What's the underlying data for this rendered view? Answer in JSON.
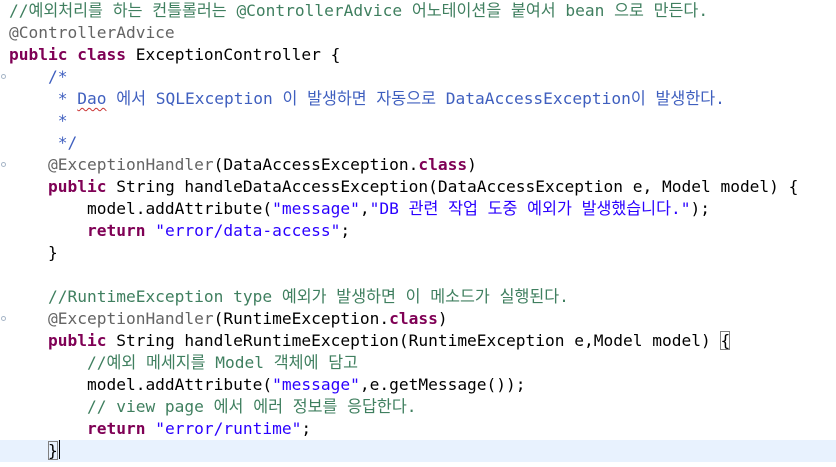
{
  "editor": {
    "current_line": 20,
    "lines": [
      {
        "fold": false,
        "segs": [
          {
            "t": "//예외처리를 하는 컨틀롤러는 @ControllerAdvice 어노테이션을 붙여서 bean 으로 만든다.",
            "c": "cm"
          }
        ]
      },
      {
        "fold": false,
        "segs": [
          {
            "t": "@ControllerAdvice",
            "c": "ann"
          }
        ]
      },
      {
        "fold": false,
        "segs": [
          {
            "t": "public",
            "c": "kw"
          },
          {
            "t": " "
          },
          {
            "t": "class",
            "c": "kw"
          },
          {
            "t": " ExceptionController {"
          }
        ]
      },
      {
        "fold": true,
        "segs": [
          {
            "t": "    "
          },
          {
            "t": "/*",
            "c": "jd"
          }
        ]
      },
      {
        "fold": false,
        "segs": [
          {
            "t": "     * ",
            "c": "jd"
          },
          {
            "t": "Dao",
            "c": "jd squig"
          },
          {
            "t": " 에서 SQLException 이 발생하면 자동으로 DataAccessException이 발생한다.",
            "c": "jd"
          }
        ]
      },
      {
        "fold": false,
        "segs": [
          {
            "t": "     *",
            "c": "jd"
          }
        ]
      },
      {
        "fold": false,
        "segs": [
          {
            "t": "     */",
            "c": "jd"
          }
        ]
      },
      {
        "fold": true,
        "segs": [
          {
            "t": "    "
          },
          {
            "t": "@ExceptionHandler",
            "c": "ann"
          },
          {
            "t": "(DataAccessException."
          },
          {
            "t": "class",
            "c": "kw"
          },
          {
            "t": ")"
          }
        ]
      },
      {
        "fold": false,
        "segs": [
          {
            "t": "    "
          },
          {
            "t": "public",
            "c": "kw"
          },
          {
            "t": " String handleDataAccessException(DataAccessException e, Model model) {"
          }
        ]
      },
      {
        "fold": false,
        "segs": [
          {
            "t": "        model.addAttribute("
          },
          {
            "t": "\"message\"",
            "c": "str"
          },
          {
            "t": ","
          },
          {
            "t": "\"DB 관련 작업 도중 예외가 발생했습니다.\"",
            "c": "str"
          },
          {
            "t": ");"
          }
        ]
      },
      {
        "fold": false,
        "segs": [
          {
            "t": "        "
          },
          {
            "t": "return",
            "c": "kw"
          },
          {
            "t": " "
          },
          {
            "t": "\"error/data-access\"",
            "c": "str"
          },
          {
            "t": ";"
          }
        ]
      },
      {
        "fold": false,
        "segs": [
          {
            "t": "    }"
          }
        ]
      },
      {
        "fold": false,
        "segs": [
          {
            "t": ""
          }
        ]
      },
      {
        "fold": false,
        "segs": [
          {
            "t": "    "
          },
          {
            "t": "//RuntimeException type 예외가 발생하면 이 메소드가 실행된다.",
            "c": "cm"
          }
        ]
      },
      {
        "fold": true,
        "segs": [
          {
            "t": "    "
          },
          {
            "t": "@ExceptionHandler",
            "c": "ann"
          },
          {
            "t": "(RuntimeException."
          },
          {
            "t": "class",
            "c": "kw"
          },
          {
            "t": ")"
          }
        ]
      },
      {
        "fold": false,
        "segs": [
          {
            "t": "    "
          },
          {
            "t": "public",
            "c": "kw"
          },
          {
            "t": " String handleRuntimeException(RuntimeException e,Model model) "
          },
          {
            "t": "{",
            "c": "bracket-match"
          }
        ]
      },
      {
        "fold": false,
        "segs": [
          {
            "t": "        "
          },
          {
            "t": "//예외 메세지를 Model 객체에 담고",
            "c": "cm"
          }
        ]
      },
      {
        "fold": false,
        "segs": [
          {
            "t": "        model.addAttribute("
          },
          {
            "t": "\"message\"",
            "c": "str"
          },
          {
            "t": ",e.getMessage());"
          }
        ]
      },
      {
        "fold": false,
        "segs": [
          {
            "t": "        "
          },
          {
            "t": "// view page 에서 에러 정보를 응답한다.",
            "c": "cm"
          }
        ]
      },
      {
        "fold": false,
        "segs": [
          {
            "t": "        "
          },
          {
            "t": "return",
            "c": "kw"
          },
          {
            "t": " "
          },
          {
            "t": "\"error/runtime\"",
            "c": "str"
          },
          {
            "t": ";"
          }
        ]
      },
      {
        "fold": false,
        "segs": [
          {
            "t": "    "
          },
          {
            "t": "}",
            "c": "bracket-match"
          }
        ],
        "caret": true
      }
    ]
  }
}
